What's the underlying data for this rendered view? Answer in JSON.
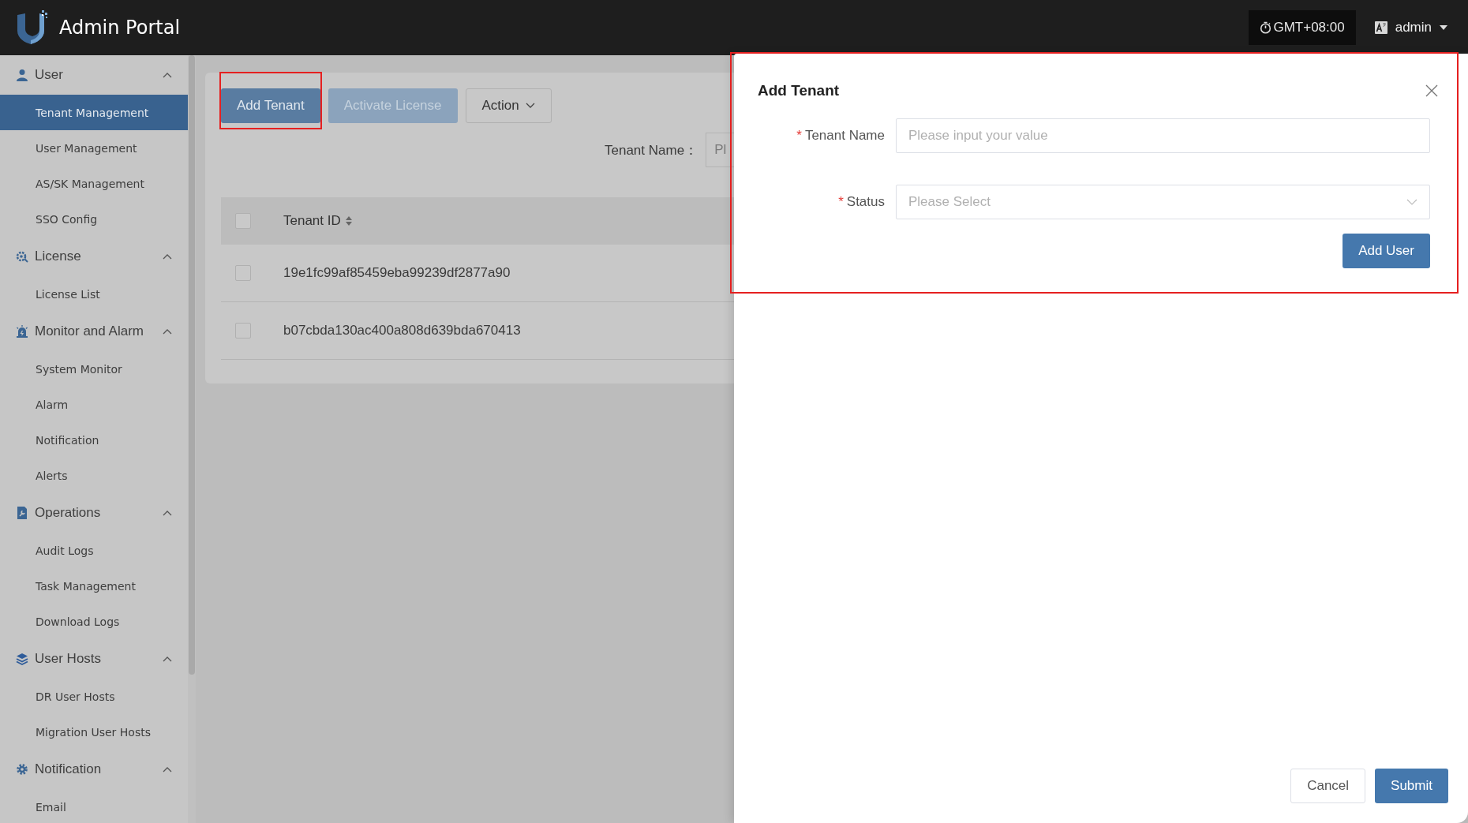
{
  "header": {
    "title": "Admin Portal",
    "timezone": "GMT+08:00",
    "user": "admin"
  },
  "sidebar": {
    "groups": [
      {
        "label": "User",
        "expanded": true,
        "items": [
          {
            "label": "Tenant Management",
            "selected": true
          },
          {
            "label": "User Management",
            "selected": false
          },
          {
            "label": "AS/SK Management",
            "selected": false
          },
          {
            "label": "SSO Config",
            "selected": false
          }
        ]
      },
      {
        "label": "License",
        "expanded": true,
        "items": [
          {
            "label": "License List",
            "selected": false
          }
        ]
      },
      {
        "label": "Monitor and Alarm",
        "expanded": true,
        "items": [
          {
            "label": "System Monitor",
            "selected": false
          },
          {
            "label": "Alarm",
            "selected": false
          },
          {
            "label": "Notification",
            "selected": false
          },
          {
            "label": "Alerts",
            "selected": false
          }
        ]
      },
      {
        "label": "Operations",
        "expanded": true,
        "items": [
          {
            "label": "Audit Logs",
            "selected": false
          },
          {
            "label": "Task Management",
            "selected": false
          },
          {
            "label": "Download Logs",
            "selected": false
          }
        ]
      },
      {
        "label": "User Hosts",
        "expanded": true,
        "items": [
          {
            "label": "DR User Hosts",
            "selected": false
          },
          {
            "label": "Migration User Hosts",
            "selected": false
          }
        ]
      },
      {
        "label": "Notification",
        "expanded": true,
        "items": [
          {
            "label": "Email",
            "selected": false
          }
        ]
      }
    ]
  },
  "toolbar": {
    "buttons": [
      {
        "label": "Add Tenant",
        "kind": "primary",
        "highlighted": true
      },
      {
        "label": "Activate License",
        "kind": "disabled",
        "highlighted": false
      },
      {
        "label": "Action",
        "kind": "dropdown",
        "highlighted": false
      }
    ]
  },
  "filter": {
    "label": "Tenant Name：",
    "placeholder": "Pl"
  },
  "table": {
    "all_checked": false,
    "columns": [
      {
        "label": "Tenant ID",
        "sortable": true
      }
    ],
    "rows": [
      {
        "checked": false,
        "cells": [
          "19e1fc99af85459eba99239df2877a90"
        ]
      },
      {
        "checked": false,
        "cells": [
          "b07cbda130ac400a808d639bda670413"
        ]
      }
    ]
  },
  "drawer": {
    "title": "Add Tenant",
    "highlighted": true,
    "fields": [
      {
        "kind": "input",
        "label": "Tenant Name",
        "required_mark": "*",
        "placeholder": "Please input your value"
      },
      {
        "kind": "select",
        "label": "Status",
        "required_mark": "*",
        "placeholder": "Please Select"
      }
    ],
    "add_button": "Add User",
    "cancel_button": "Cancel",
    "submit_button": "Submit"
  }
}
